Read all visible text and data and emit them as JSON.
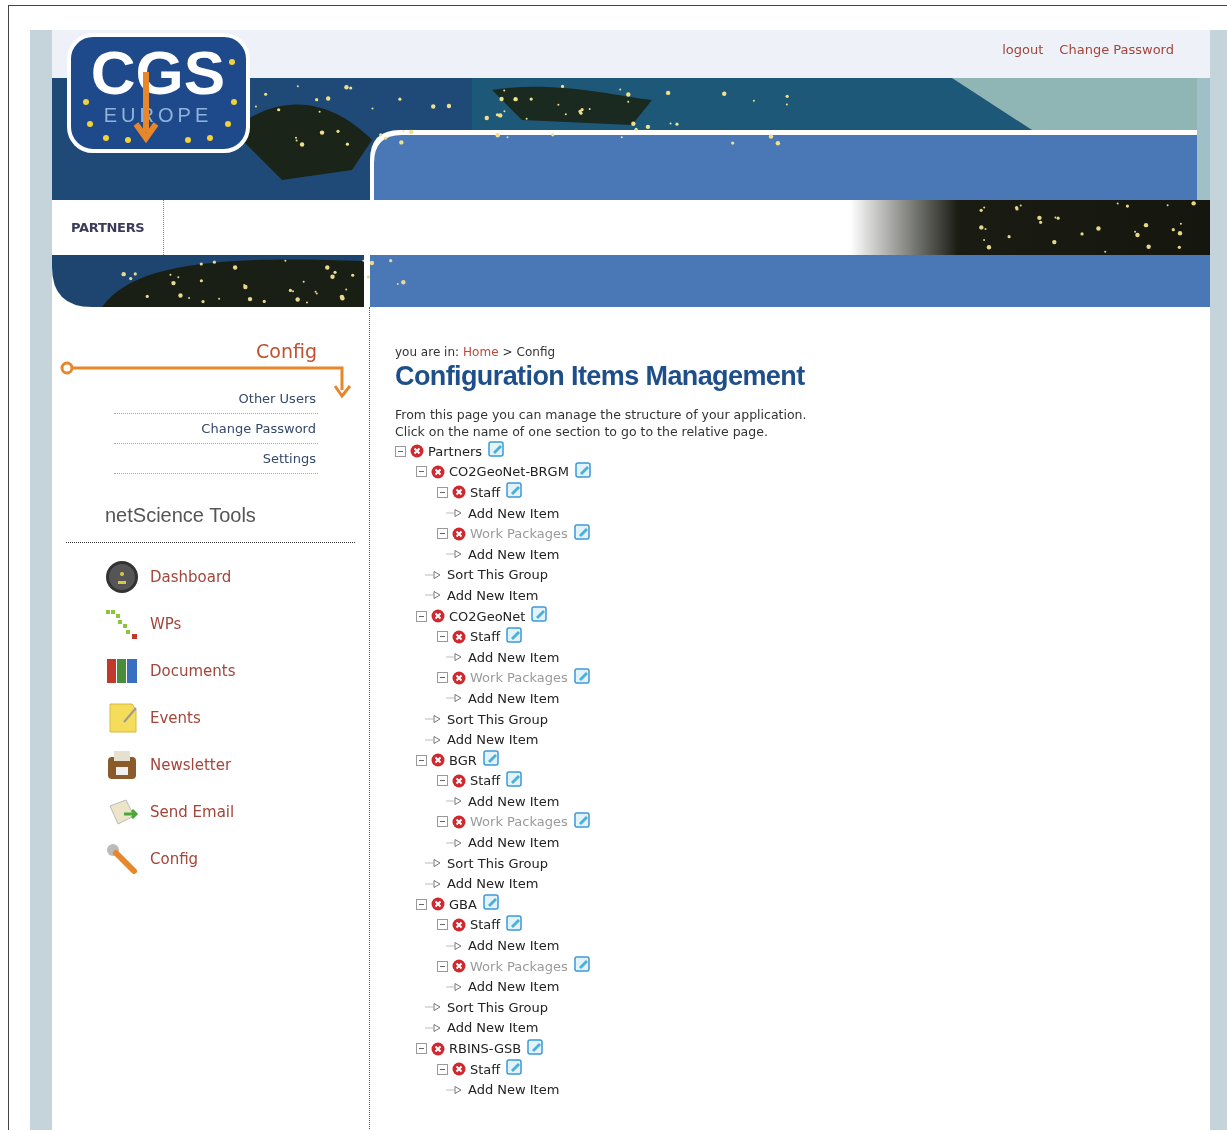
{
  "header": {
    "logo_top": "CGS",
    "logo_bottom": "EUROPE",
    "links": [
      "logout",
      "Change Password"
    ]
  },
  "nav": {
    "items": [
      "PARTNERS"
    ]
  },
  "sidebar": {
    "section_title": "Config",
    "submenu": [
      "Other Users",
      "Change Password",
      "Settings"
    ],
    "tools_title": "netScience Tools",
    "tools": [
      {
        "label": "Dashboard",
        "kind": "dashboard"
      },
      {
        "label": "WPs",
        "kind": "wps"
      },
      {
        "label": "Documents",
        "kind": "documents"
      },
      {
        "label": "Events",
        "kind": "events"
      },
      {
        "label": "Newsletter",
        "kind": "newsletter"
      },
      {
        "label": "Send Email",
        "kind": "email"
      },
      {
        "label": "Config",
        "kind": "config"
      }
    ]
  },
  "breadcrumb": {
    "label": "you are in:",
    "path": [
      {
        "label": "Home",
        "link": true
      },
      {
        "label": "Config",
        "link": false
      }
    ],
    "separator": ">"
  },
  "title": "Configuration Items Management",
  "description": [
    "From this page you can manage the structure of your application.",
    "Click on the name of one section to go to the relative page."
  ],
  "tree": {
    "kind": "node",
    "label": "Partners",
    "expanded": true,
    "dimmed": false,
    "children": [
      {
        "kind": "node",
        "label": "CO2GeoNet-BRGM",
        "expanded": true,
        "dimmed": false,
        "children": [
          {
            "kind": "node",
            "label": "Staff",
            "expanded": true,
            "dimmed": false,
            "children": [
              {
                "kind": "action",
                "label": "Add New Item"
              }
            ]
          },
          {
            "kind": "node",
            "label": "Work Packages",
            "expanded": true,
            "dimmed": true,
            "children": [
              {
                "kind": "action",
                "label": "Add New Item"
              }
            ]
          },
          {
            "kind": "action",
            "label": "Sort This Group"
          },
          {
            "kind": "action",
            "label": "Add New Item"
          }
        ]
      },
      {
        "kind": "node",
        "label": "CO2GeoNet",
        "expanded": true,
        "dimmed": false,
        "children": [
          {
            "kind": "node",
            "label": "Staff",
            "expanded": true,
            "dimmed": false,
            "children": [
              {
                "kind": "action",
                "label": "Add New Item"
              }
            ]
          },
          {
            "kind": "node",
            "label": "Work Packages",
            "expanded": true,
            "dimmed": true,
            "children": [
              {
                "kind": "action",
                "label": "Add New Item"
              }
            ]
          },
          {
            "kind": "action",
            "label": "Sort This Group"
          },
          {
            "kind": "action",
            "label": "Add New Item"
          }
        ]
      },
      {
        "kind": "node",
        "label": "BGR",
        "expanded": true,
        "dimmed": false,
        "children": [
          {
            "kind": "node",
            "label": "Staff",
            "expanded": true,
            "dimmed": false,
            "children": [
              {
                "kind": "action",
                "label": "Add New Item"
              }
            ]
          },
          {
            "kind": "node",
            "label": "Work Packages",
            "expanded": true,
            "dimmed": true,
            "children": [
              {
                "kind": "action",
                "label": "Add New Item"
              }
            ]
          },
          {
            "kind": "action",
            "label": "Sort This Group"
          },
          {
            "kind": "action",
            "label": "Add New Item"
          }
        ]
      },
      {
        "kind": "node",
        "label": "GBA",
        "expanded": true,
        "dimmed": false,
        "children": [
          {
            "kind": "node",
            "label": "Staff",
            "expanded": true,
            "dimmed": false,
            "children": [
              {
                "kind": "action",
                "label": "Add New Item"
              }
            ]
          },
          {
            "kind": "node",
            "label": "Work Packages",
            "expanded": true,
            "dimmed": true,
            "children": [
              {
                "kind": "action",
                "label": "Add New Item"
              }
            ]
          },
          {
            "kind": "action",
            "label": "Sort This Group"
          },
          {
            "kind": "action",
            "label": "Add New Item"
          }
        ]
      },
      {
        "kind": "node",
        "label": "RBINS-GSB",
        "expanded": true,
        "dimmed": false,
        "children": [
          {
            "kind": "node",
            "label": "Staff",
            "expanded": true,
            "dimmed": false,
            "children": [
              {
                "kind": "action",
                "label": "Add New Item"
              }
            ]
          }
        ]
      }
    ]
  }
}
